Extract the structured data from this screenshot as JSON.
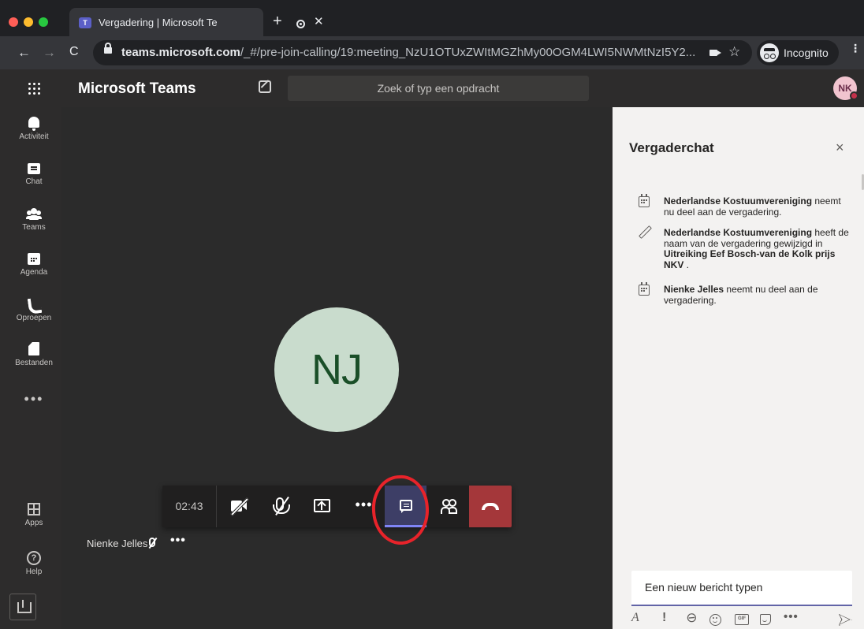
{
  "browser": {
    "tab_title": "Vergadering | Microsoft Teams",
    "tab_close": "✕",
    "new_tab": "+",
    "back": "←",
    "forward": "→",
    "reload": "C",
    "url_host": "teams.microsoft.com",
    "url_path": "/_#/pre-join-calling/19:meeting_NzU1OTUxZWItMGZhMy00OGM4LWI5NWMtNzI5Y2...",
    "bookmark": "☆",
    "incognito_label": "Incognito",
    "menu": "⋮"
  },
  "teams": {
    "app_name": "Microsoft Teams",
    "search_placeholder": "Zoek of typ een opdracht",
    "user_initials": "NK",
    "rail": {
      "items": [
        {
          "label": "Activiteit"
        },
        {
          "label": "Chat"
        },
        {
          "label": "Teams"
        },
        {
          "label": "Agenda"
        },
        {
          "label": "Oproepen"
        },
        {
          "label": "Bestanden"
        }
      ],
      "more": "•••",
      "apps_label": "Apps",
      "help_label": "Help",
      "help_glyph": "?"
    }
  },
  "meeting": {
    "participant_initials": "NJ",
    "timer": "02:43",
    "more": "•••",
    "participant_name": "Nienke Jelles",
    "name_more": "•••"
  },
  "chat": {
    "title": "Vergaderchat",
    "close": "×",
    "messages": [
      {
        "bold": "Nederlandse Kostuumvereniging",
        "text": " neemt nu deel aan de vergadering."
      },
      {
        "bold": "Nederlandse Kostuumvereniging",
        "text": " heeft de naam van de vergadering gewijzigd in ",
        "bold2": "Uitreiking Eef Bosch-van de Kolk prijs NKV",
        "text2": " ."
      },
      {
        "bold": "Nienke Jelles",
        "text": " neemt nu deel aan de vergadering."
      }
    ],
    "composer_placeholder": "Een nieuw bericht typen",
    "toolbar": {
      "format": "A",
      "important": "!",
      "attach": "⊘",
      "gif": "GIF",
      "more": "•••"
    }
  },
  "colors": {
    "teams_accent": "#6264a7",
    "hangup": "#a4373a",
    "annotation": "#e8232a"
  }
}
